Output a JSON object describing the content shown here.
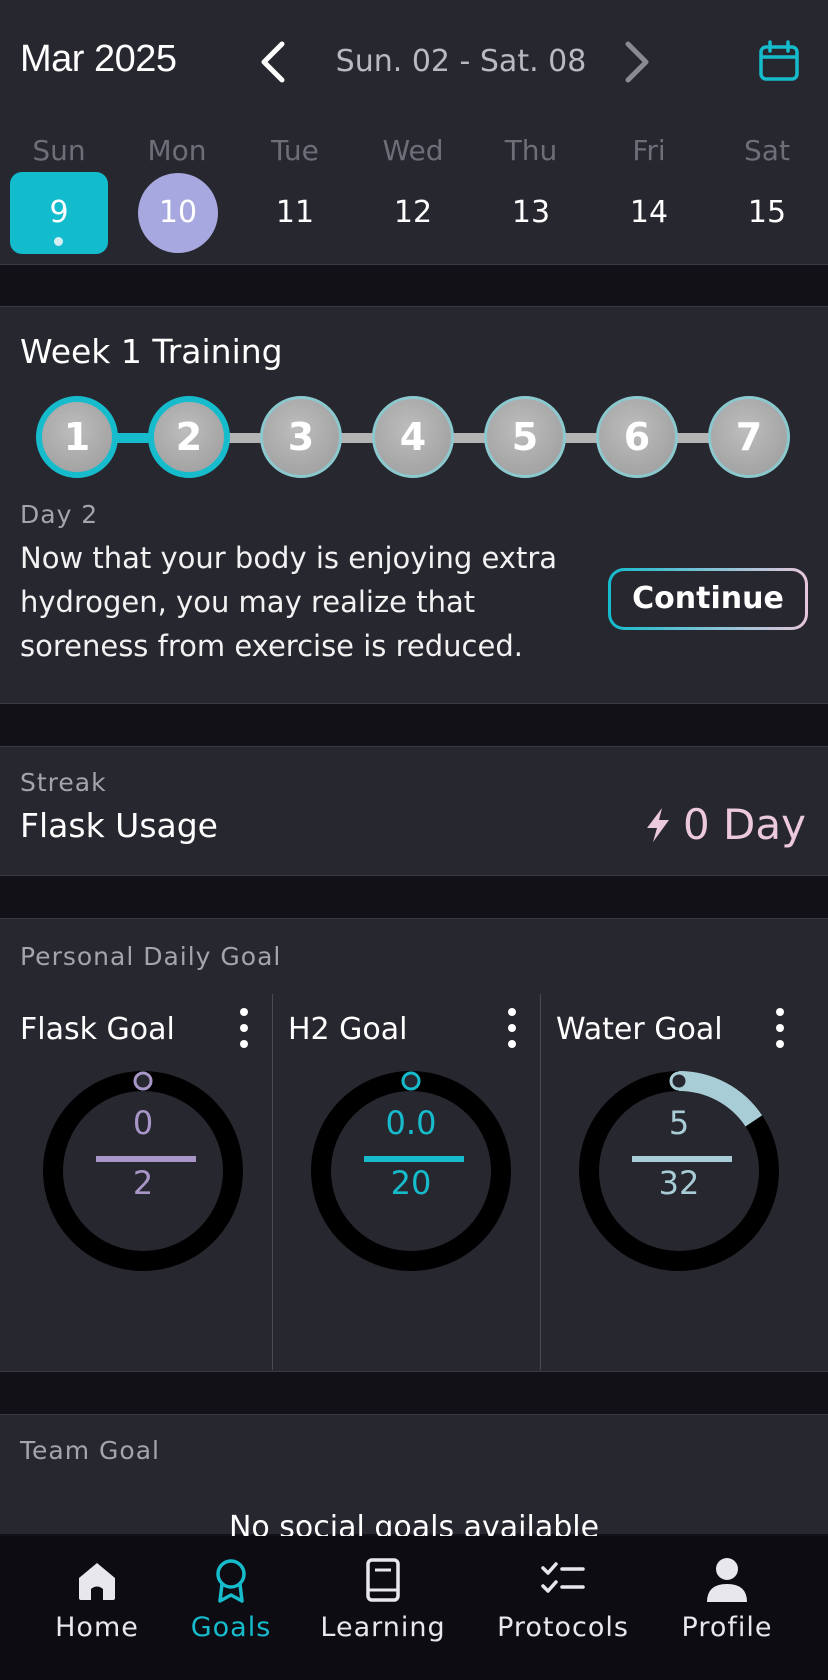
{
  "header": {
    "month": "Mar 2025",
    "week_range": "Sun. 02 - Sat. 08",
    "days": [
      {
        "label": "Sun",
        "num": "9"
      },
      {
        "label": "Mon",
        "num": "10"
      },
      {
        "label": "Tue",
        "num": "11"
      },
      {
        "label": "Wed",
        "num": "12"
      },
      {
        "label": "Thu",
        "num": "13"
      },
      {
        "label": "Fri",
        "num": "14"
      },
      {
        "label": "Sat",
        "num": "15"
      }
    ]
  },
  "training": {
    "title": "Week 1 Training",
    "steps": [
      "1",
      "2",
      "3",
      "4",
      "5",
      "6",
      "7"
    ],
    "day_caption": "Day 2",
    "body": "Now that your body is enjoying extra hydrogen, you may realize that soreness from exercise is reduced.",
    "continue_label": "Continue"
  },
  "streak": {
    "label": "Streak",
    "title": "Flask Usage",
    "value": "0 Day"
  },
  "daily_goal": {
    "label": "Personal Daily Goal",
    "goals": [
      {
        "title": "Flask Goal",
        "value": "0",
        "target": "2",
        "color": "#a896c8",
        "progress": 0
      },
      {
        "title": "H2 Goal",
        "value": "0.0",
        "target": "20",
        "color": "#16bccc",
        "progress": 0
      },
      {
        "title": "Water Goal",
        "value": "5",
        "target": "32",
        "color": "#a9cdd6",
        "progress": 0.156
      }
    ]
  },
  "team": {
    "label": "Team Goal",
    "empty": "No social goals available"
  },
  "tabs": [
    {
      "label": "Home",
      "icon": "home-icon"
    },
    {
      "label": "Goals",
      "icon": "award-icon"
    },
    {
      "label": "Learning",
      "icon": "book-icon"
    },
    {
      "label": "Protocols",
      "icon": "checklist-icon"
    },
    {
      "label": "Profile",
      "icon": "user-icon"
    }
  ],
  "colors": {
    "accent": "#16bccc",
    "selected_day": "#a8a8e0",
    "streak": "#ecc9dd"
  }
}
